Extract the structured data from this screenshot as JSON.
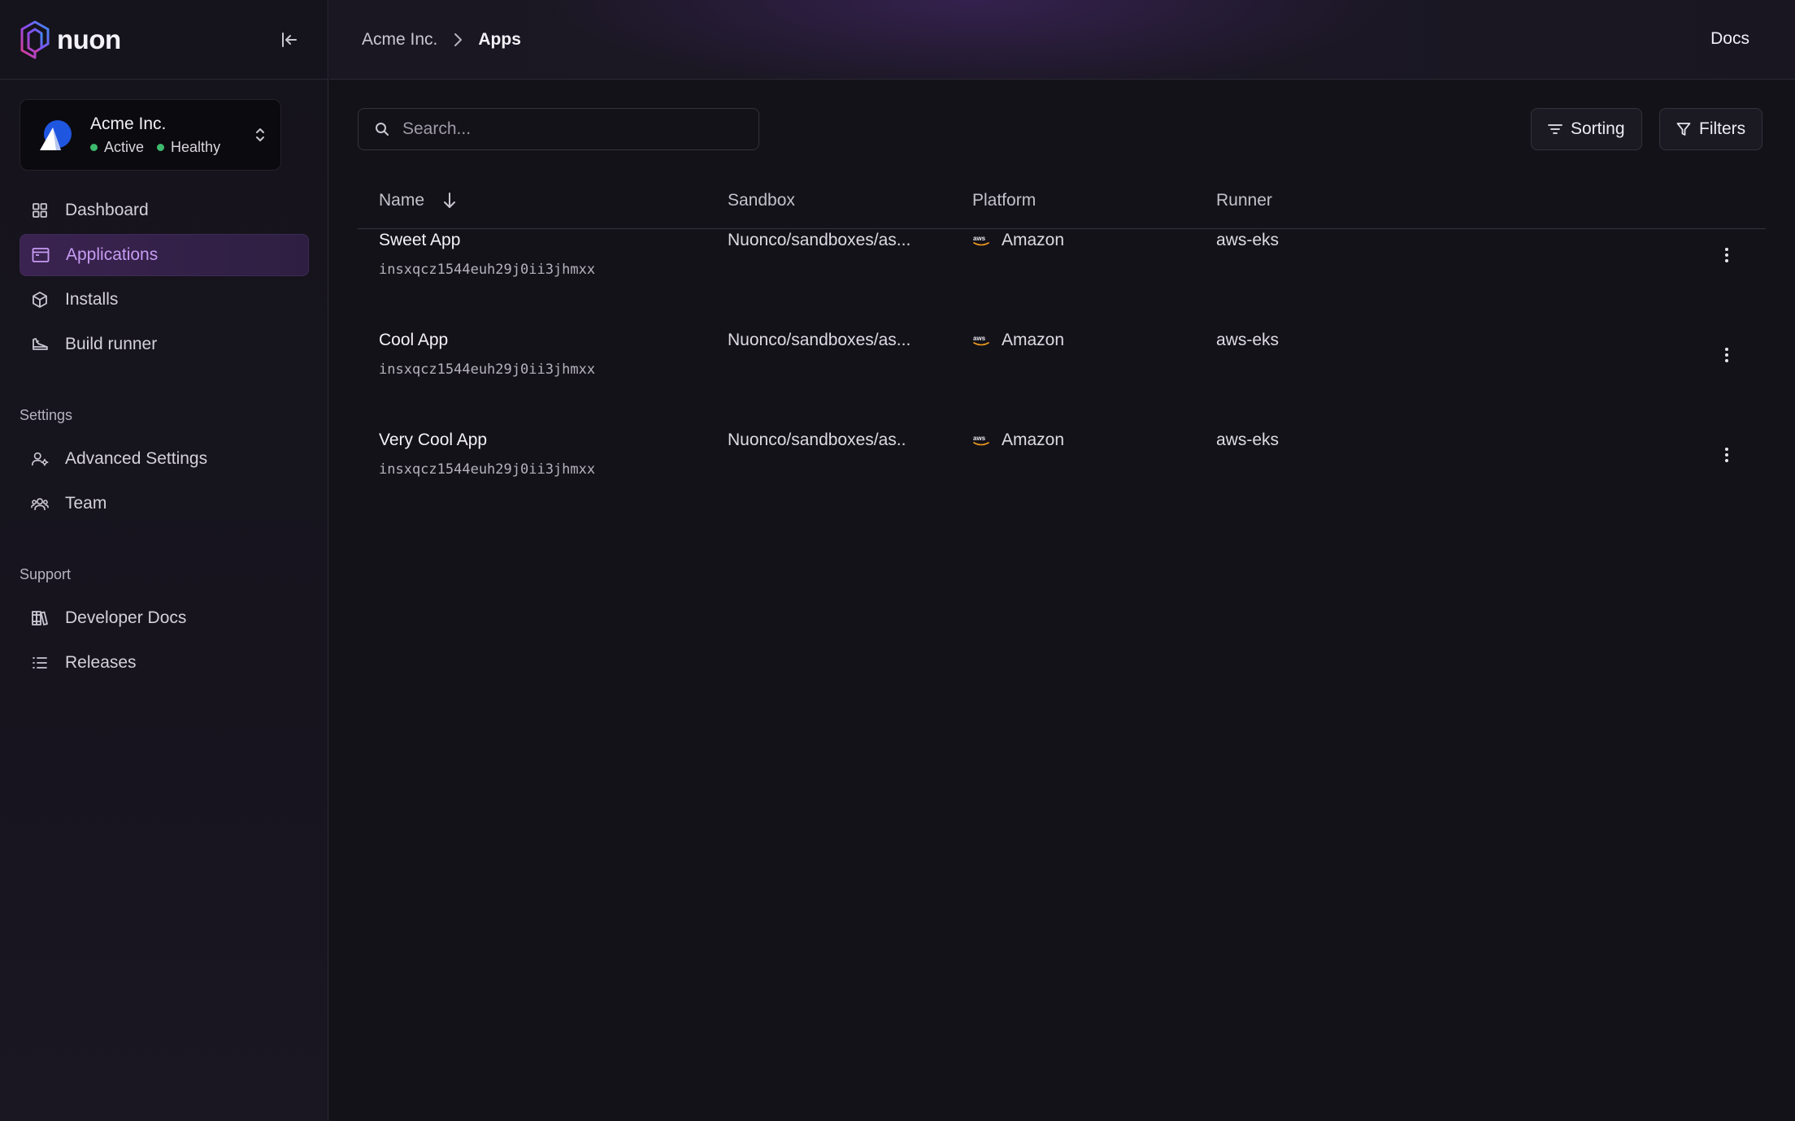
{
  "brand": {
    "name": "nuon"
  },
  "org": {
    "name": "Acme Inc.",
    "status_active": "Active",
    "status_health": "Healthy",
    "status_color": "#3dba6e"
  },
  "nav": {
    "main": [
      {
        "label": "Dashboard",
        "icon": "grid-icon"
      },
      {
        "label": "Applications",
        "icon": "app-window-icon",
        "active": true
      },
      {
        "label": "Installs",
        "icon": "cube-icon"
      },
      {
        "label": "Build runner",
        "icon": "sneaker-icon"
      }
    ],
    "settings_label": "Settings",
    "settings": [
      {
        "label": "Advanced Settings",
        "icon": "user-gear-icon"
      },
      {
        "label": "Team",
        "icon": "users-icon"
      }
    ],
    "support_label": "Support",
    "support": [
      {
        "label": "Developer Docs",
        "icon": "books-icon"
      },
      {
        "label": "Releases",
        "icon": "list-icon"
      }
    ]
  },
  "breadcrumb": {
    "org": "Acme Inc.",
    "current": "Apps"
  },
  "header": {
    "docs_label": "Docs"
  },
  "toolbar": {
    "search_placeholder": "Search...",
    "sorting_label": "Sorting",
    "filters_label": "Filters"
  },
  "table": {
    "columns": {
      "name": "Name",
      "sandbox": "Sandbox",
      "platform": "Platform",
      "runner": "Runner"
    },
    "rows": [
      {
        "name": "Sweet App",
        "id": "insxqcz1544euh29j0ii3jhmxx",
        "sandbox": "Nuonco/sandboxes/as...",
        "platform": "Amazon",
        "runner": "aws-eks"
      },
      {
        "name": "Cool App",
        "id": "insxqcz1544euh29j0ii3jhmxx",
        "sandbox": "Nuonco/sandboxes/as...",
        "platform": "Amazon",
        "runner": "aws-eks"
      },
      {
        "name": "Very Cool App",
        "id": "insxqcz1544euh29j0ii3jhmxx",
        "sandbox": "Nuonco/sandboxes/as..",
        "platform": "Amazon",
        "runner": "aws-eks"
      }
    ]
  },
  "colors": {
    "accent": "#c79cf3",
    "active_bg": "#3a2350",
    "background": "#141219",
    "aws_orange": "#f29c1f"
  }
}
